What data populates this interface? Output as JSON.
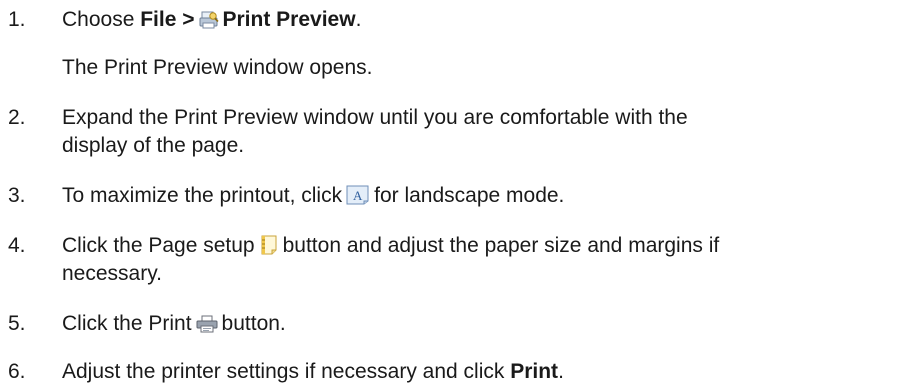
{
  "steps": [
    {
      "number": "1.",
      "parts": {
        "a": "Choose ",
        "b": "File >",
        "c": "Print Preview",
        "d": "."
      },
      "icon": "print-preview-icon",
      "note": "The Print Preview window opens."
    },
    {
      "number": "2.",
      "line1": "Expand the Print Preview window until you are comfortable with the",
      "line2": "display of the page."
    },
    {
      "number": "3.",
      "a": "To maximize the printout, click",
      "b": "for landscape mode.",
      "icon": "landscape-icon"
    },
    {
      "number": "4.",
      "a": "Click the Page setup",
      "b": "button and adjust the paper size and margins if",
      "line2": "necessary.",
      "icon": "page-setup-icon"
    },
    {
      "number": "5.",
      "a": "Click the Print",
      "b": "button.",
      "icon": "printer-icon"
    },
    {
      "number": "6.",
      "a": "Adjust the printer settings if necessary and click ",
      "b": "Print",
      "c": "."
    }
  ]
}
